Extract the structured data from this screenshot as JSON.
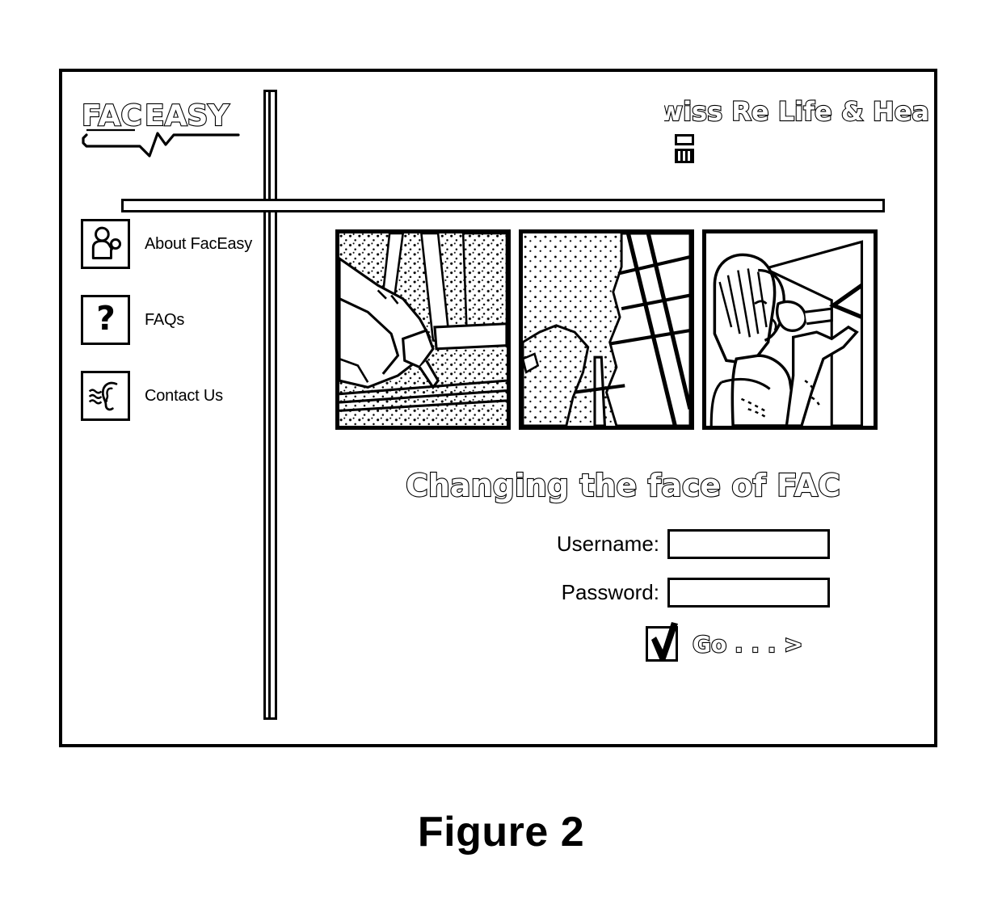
{
  "figure": {
    "caption": "Figure 2"
  },
  "brand": {
    "logo_text_1": "FAC",
    "logo_text_2": "EASY",
    "logo_name": "FacEasy"
  },
  "partner": {
    "name": "Swiss Re Life & Hea",
    "icon": "building-icon"
  },
  "sidebar": {
    "items": [
      {
        "label": "About FacEasy",
        "icon": "person-presenter-icon"
      },
      {
        "label": "FAQs",
        "icon": "question-mark-icon"
      },
      {
        "label": "Contact Us",
        "icon": "ear-listening-icon"
      }
    ]
  },
  "hero": {
    "panels": [
      {
        "alt": "hand-writing-with-pen-illustration"
      },
      {
        "alt": "abstract-ladder-structure-illustration"
      },
      {
        "alt": "woman-pointing-at-display-illustration"
      }
    ]
  },
  "tagline": {
    "text": "Changing the face of FAC"
  },
  "login": {
    "username_label": "Username:",
    "username_value": "",
    "username_placeholder": "",
    "password_label": "Password:",
    "password_value": "",
    "password_placeholder": "",
    "submit_label": "Go . . . >",
    "submit_checked": true
  },
  "colors": {
    "ink": "#000000",
    "page": "#ffffff"
  }
}
